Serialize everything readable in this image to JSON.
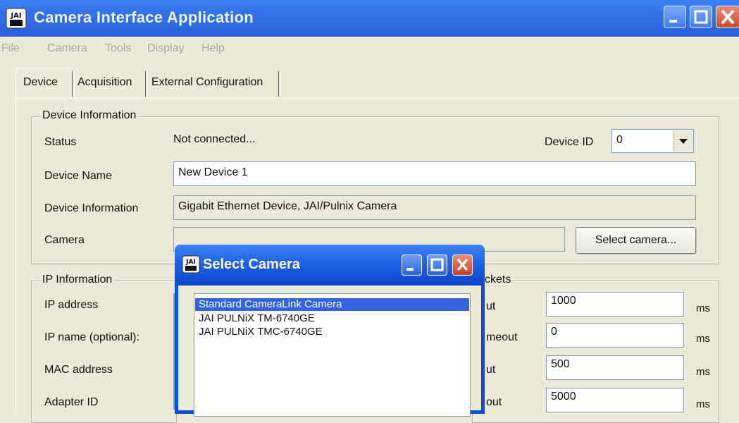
{
  "window": {
    "title": "Camera Interface Application",
    "icon": "jai-app-icon"
  },
  "menu": [
    "File",
    "Camera",
    "Tools",
    "Display",
    "Help"
  ],
  "tabs": [
    {
      "label": "Device",
      "active": true
    },
    {
      "label": "Acquisition",
      "active": false
    },
    {
      "label": "External Configuration",
      "active": false
    }
  ],
  "device_info": {
    "group_title": "Device Information",
    "status_label": "Status",
    "status_value": "Not connected...",
    "device_id_label": "Device ID",
    "device_id_value": "0",
    "device_name_label": "Device Name",
    "device_name_value": "New Device 1",
    "device_information_label": "Device Information",
    "device_information_value": "Gigabit Ethernet Device, JAI/Pulnix Camera",
    "camera_label": "Camera",
    "camera_value": "",
    "select_camera_button": "Select camera..."
  },
  "ip_info": {
    "group_title": "IP Information",
    "ip_address_label": "IP address",
    "ip_name_label": "IP name (optional):",
    "mac_address_label": "MAC address",
    "adapter_id_label": "Adapter ID"
  },
  "packets": {
    "group_title_partial": "ckets",
    "rows": [
      {
        "label_partial": "ut",
        "value": "1000",
        "unit": "ms"
      },
      {
        "label_partial": "meout",
        "value": "0",
        "unit": "ms"
      },
      {
        "label_partial": "ut",
        "value": "500",
        "unit": "ms"
      },
      {
        "label_partial": "out",
        "value": "5000",
        "unit": "ms"
      }
    ]
  },
  "select_camera_dialog": {
    "title": "Select Camera",
    "items": [
      {
        "label": "Standard CameraLink Camera",
        "selected": true
      },
      {
        "label": "JAI PULNiX TM-6740GE",
        "selected": false
      },
      {
        "label": "JAI PULNiX TMC-6740GE",
        "selected": false
      }
    ]
  },
  "colors": {
    "titlebar_blue": "#3170e6",
    "dialog_border": "#0b4fd8",
    "selection": "#3264e0",
    "window_bg": "#ece9d8"
  }
}
